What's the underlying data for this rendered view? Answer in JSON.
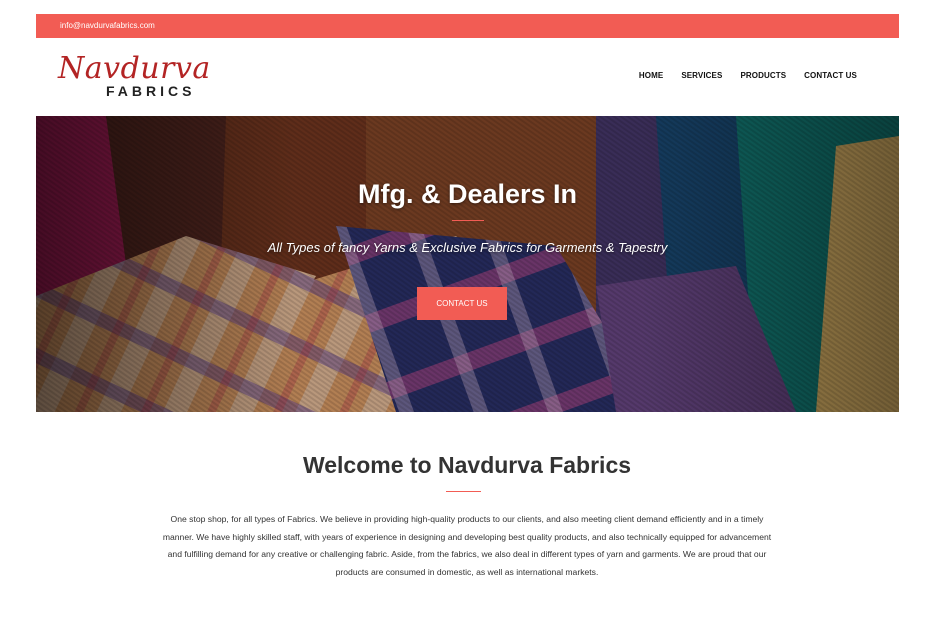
{
  "topbar": {
    "email": "info@navdurvafabrics.com"
  },
  "logo": {
    "script": "Navdurva",
    "sub": "FABRICS"
  },
  "nav": {
    "items": [
      "HOME",
      "SERVICES",
      "PRODUCTS",
      "CONTACT US"
    ]
  },
  "hero": {
    "title": "Mfg. & Dealers In",
    "subtitle": "All Types of fancy Yarns & Exclusive Fabrics for Garments & Tapestry",
    "button": "CONTACT US"
  },
  "welcome": {
    "title": "Welcome to Navdurva Fabrics",
    "text": "One stop shop, for all types of Fabrics. We believe in providing high-quality products to our clients, and also meeting client demand efficiently and in a timely manner. We have highly skilled staff, with years of experience in designing and developing best quality products, and also technically equipped for advancement and fulfilling demand for any creative or challenging fabric. Aside, from the fabrics, we also deal in different types of yarn and garments. We are proud that our products are consumed in domestic, as well as international markets."
  },
  "colors": {
    "accent": "#f25c54",
    "logo": "#b32424"
  }
}
